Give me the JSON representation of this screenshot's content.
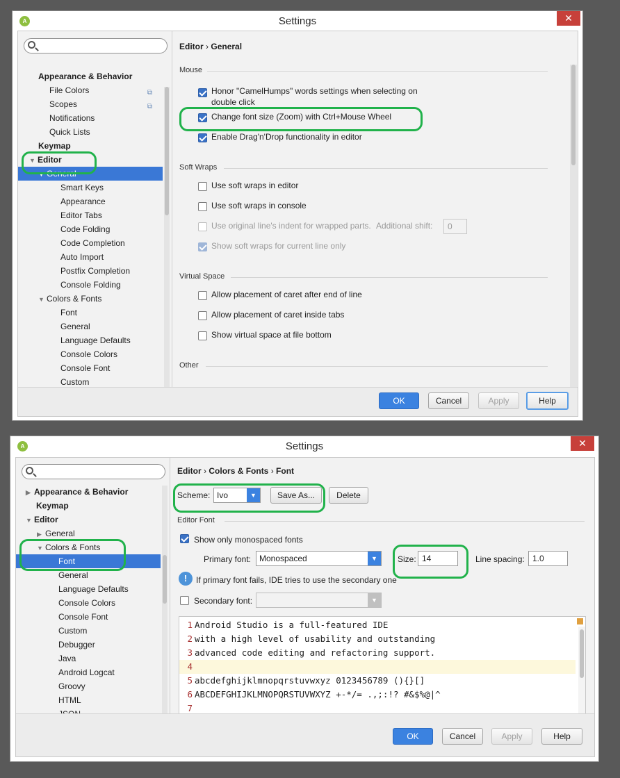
{
  "window1": {
    "title": "Settings",
    "close": "✕",
    "search": {
      "value": "",
      "placeholder": ""
    },
    "tree": [
      {
        "label": "Appearance & Behavior",
        "bold": true
      },
      {
        "label": "File Colors"
      },
      {
        "label": "Scopes"
      },
      {
        "label": "Notifications"
      },
      {
        "label": "Quick Lists"
      },
      {
        "label": "Keymap",
        "bold": true
      },
      {
        "label": "Editor",
        "bold": true
      },
      {
        "label": "General",
        "selected": true
      },
      {
        "label": "Smart Keys"
      },
      {
        "label": "Appearance"
      },
      {
        "label": "Editor Tabs"
      },
      {
        "label": "Code Folding"
      },
      {
        "label": "Code Completion"
      },
      {
        "label": "Auto Import"
      },
      {
        "label": "Postfix Completion"
      },
      {
        "label": "Console Folding"
      },
      {
        "label": "Colors & Fonts"
      },
      {
        "label": "Font"
      },
      {
        "label": "General"
      },
      {
        "label": "Language Defaults"
      },
      {
        "label": "Console Colors"
      },
      {
        "label": "Console Font"
      },
      {
        "label": "Custom"
      }
    ],
    "breadcrumb": {
      "part1": "Editor",
      "sep": "›",
      "part2": "General"
    },
    "sections": {
      "mouse": "Mouse",
      "soft_wraps": "Soft Wraps",
      "virtual_space": "Virtual Space",
      "other": "Other"
    },
    "options": {
      "camelhumps_line1": "Honor \"CamelHumps\" words settings when selecting on",
      "camelhumps_line2": "double click",
      "zoom": "Change font size (Zoom) with Ctrl+Mouse Wheel",
      "dragdrop": "Enable Drag'n'Drop functionality in editor",
      "wrap_editor": "Use soft wraps in editor",
      "wrap_console": "Use soft wraps in console",
      "wrap_indent": "Use original line's indent for wrapped parts.",
      "additional_shift_label": "Additional shift:",
      "additional_shift_value": "0",
      "show_wraps": "Show soft wraps for current line only",
      "caret_end": "Allow placement of caret after end of line",
      "caret_tabs": "Allow placement of caret inside tabs",
      "virtual_bottom": "Show virtual space at file bottom"
    },
    "buttons": {
      "ok": "OK",
      "cancel": "Cancel",
      "apply": "Apply",
      "help": "Help"
    }
  },
  "window2": {
    "title": "Settings",
    "close": "✕",
    "search": {
      "value": "",
      "placeholder": ""
    },
    "tree": [
      {
        "label": "Appearance & Behavior",
        "bold": true
      },
      {
        "label": "Keymap",
        "bold": true
      },
      {
        "label": "Editor",
        "bold": true
      },
      {
        "label": "General"
      },
      {
        "label": "Colors & Fonts"
      },
      {
        "label": "Font",
        "selected": true
      },
      {
        "label": "General"
      },
      {
        "label": "Language Defaults"
      },
      {
        "label": "Console Colors"
      },
      {
        "label": "Console Font"
      },
      {
        "label": "Custom"
      },
      {
        "label": "Debugger"
      },
      {
        "label": "Java"
      },
      {
        "label": "Android Logcat"
      },
      {
        "label": "Groovy"
      },
      {
        "label": "HTML"
      },
      {
        "label": "JSON"
      }
    ],
    "breadcrumb": {
      "part1": "Editor",
      "sep1": "›",
      "part2": "Colors & Fonts",
      "sep2": "›",
      "part3": "Font"
    },
    "scheme_label": "Scheme:",
    "scheme_value": "Ivo",
    "save_as": "Save As...",
    "delete": "Delete",
    "editor_font_section": "Editor Font",
    "show_monospaced": "Show only monospaced fonts",
    "primary_font_label": "Primary font:",
    "primary_font_value": "Monospaced",
    "size_label": "Size:",
    "size_value": "14",
    "line_spacing_label": "Line spacing:",
    "line_spacing_value": "1.0",
    "fallback_info": "If primary font fails, IDE tries to use the secondary one",
    "secondary_font_label": "Secondary font:",
    "secondary_font_value": "",
    "preview_lines": [
      {
        "num": "1",
        "text": "Android Studio is a full-featured IDE"
      },
      {
        "num": "2",
        "text": "with a high level of usability and outstanding"
      },
      {
        "num": "3",
        "text": "advanced code editing and refactoring support."
      },
      {
        "num": "4",
        "text": ""
      },
      {
        "num": "5",
        "text": "abcdefghijklmnopqrstuvwxyz 0123456789 (){}[]"
      },
      {
        "num": "6",
        "text": "ABCDEFGHIJKLMNOPQRSTUVWXYZ +-*/= .,;:!? #&$%@|^"
      },
      {
        "num": "7",
        "text": ""
      }
    ],
    "buttons": {
      "ok": "OK",
      "cancel": "Cancel",
      "apply": "Apply",
      "help": "Help"
    }
  },
  "colors": {
    "accent": "#3a78d6",
    "highlight": "#21b24b",
    "close": "#c7403a"
  }
}
